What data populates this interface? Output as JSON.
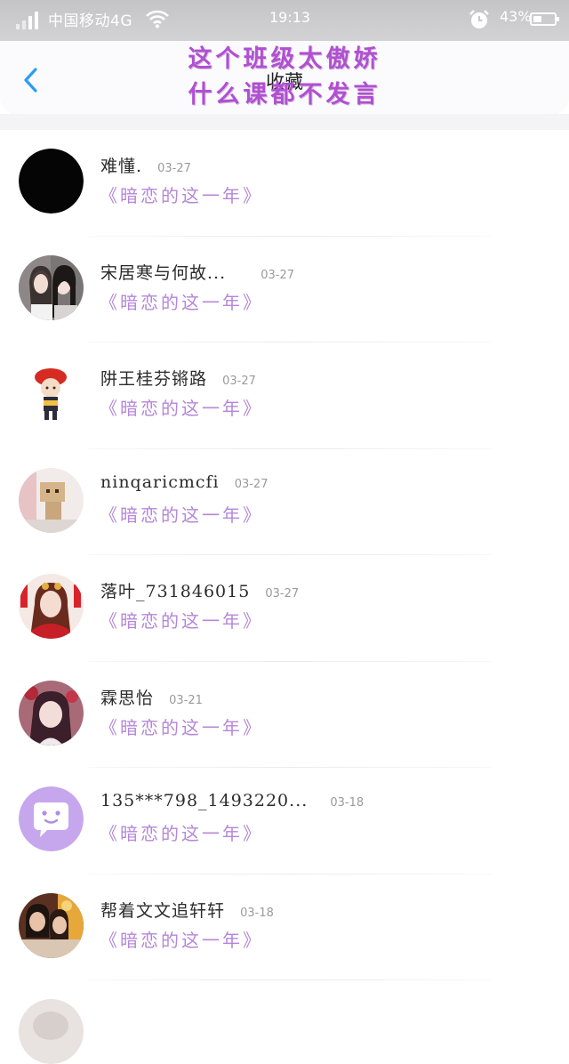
{
  "status_bar": {
    "carrier": "中国移动4G",
    "time": "19:13",
    "battery_percent": "43%",
    "battery_level": 0.43,
    "icons": [
      "signal-icon",
      "wifi-icon",
      "alarm-icon",
      "battery-icon"
    ]
  },
  "header": {
    "title": "收藏",
    "back_icon": "chevron-left-icon",
    "overlay_lines": [
      "这个班级太傲娇",
      "什么课都不发言"
    ],
    "overlay_color": "#b14fd2",
    "accent_color": "#2a9df4"
  },
  "items": [
    {
      "name": "难懂.",
      "date": "03-27",
      "book": "《暗恋的这一年》"
    },
    {
      "name": "宋居寒与何故...",
      "date": "03-27",
      "book": "《暗恋的这一年》"
    },
    {
      "name": "阱王桂芬锵路",
      "date": "03-27",
      "book": "《暗恋的这一年》"
    },
    {
      "name": "ninqaricmcfi",
      "date": "03-27",
      "book": "《暗恋的这一年》"
    },
    {
      "name": "落叶_731846015",
      "date": "03-27",
      "book": "《暗恋的这一年》"
    },
    {
      "name": "霖思怡",
      "date": "03-21",
      "book": "《暗恋的这一年》"
    },
    {
      "name": "135***798_1493220...",
      "date": "03-18",
      "book": "《暗恋的这一年》"
    },
    {
      "name": "帮着文文追轩轩",
      "date": "03-18",
      "book": "《暗恋的这一年》"
    }
  ],
  "colors": {
    "book_title": "#b487d9",
    "default_avatar_bg": "#c6a7ee"
  }
}
